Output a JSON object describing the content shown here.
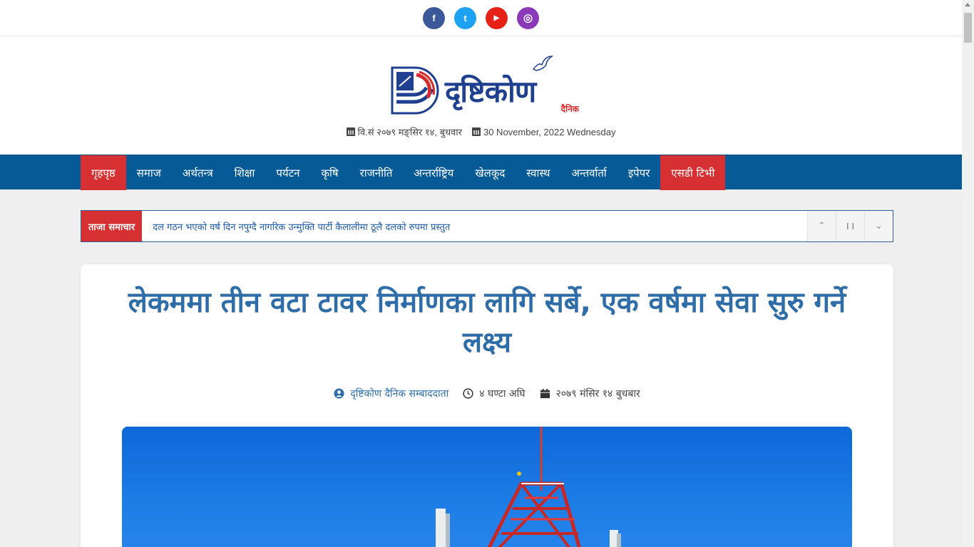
{
  "social": [
    {
      "name": "facebook",
      "glyph": "f",
      "color": "#3b5998"
    },
    {
      "name": "twitter",
      "glyph": "t",
      "color": "#1da1f2"
    },
    {
      "name": "youtube",
      "glyph": "▶",
      "color": "#e62117"
    },
    {
      "name": "instagram",
      "glyph": "◎",
      "color": "#8a3ab9"
    }
  ],
  "logo": {
    "title": "दृष्टिकोण",
    "sub": "दैनिक"
  },
  "dates": {
    "nepali": "वि.सं २०७९ मङ्सिर १४, बुधवार",
    "english": "30 November, 2022 Wednesday"
  },
  "nav": {
    "items": [
      "गृहपृष्ठ",
      "समाज",
      "अर्थतन्त्र",
      "शिक्षा",
      "पर्यटन",
      "कृषि",
      "राजनीति",
      "अन्तर्राष्ट्रिय",
      "खेलकूद",
      "स्वास्थ",
      "अन्तर्वार्ता",
      "इपेपर",
      "एसडी टिभी"
    ]
  },
  "ticker": {
    "label": "ताजा समाचार",
    "text": "दल गठन भएको वर्ष दिन नपुग्दै नागरिक उन्मुक्ति पार्टी कैलालीमा ठूलै दलको रुपमा प्रस्तुत",
    "controls": [
      "⌃",
      "❙❙",
      "⌄"
    ]
  },
  "article": {
    "headline": "लेकममा तीन वटा टावर निर्माणका लागि सर्बे, एक वर्षमा सेवा सुरु गर्ने लक्ष्य",
    "author": "दृष्टिकोण दैनिक सम्बाददाता",
    "time_ago": "४ घण्टा अघि",
    "date": "२०७९ मंसिर १४ बुधबार"
  },
  "colors": {
    "nav_bg": "#065a96",
    "accent_red": "#d63033",
    "headline": "#2e6da8"
  }
}
